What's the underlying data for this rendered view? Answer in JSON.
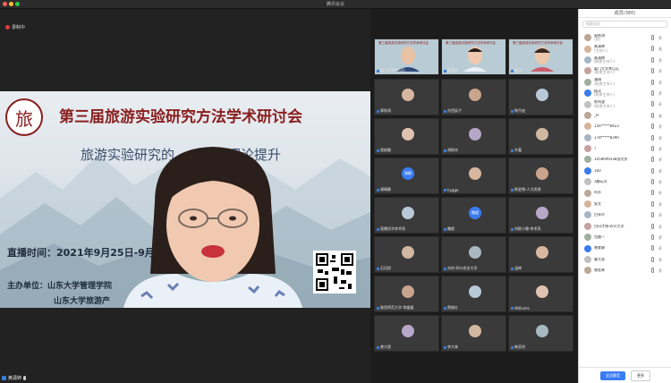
{
  "window": {
    "title": "腾讯会议"
  },
  "recording": {
    "label": "录制中"
  },
  "main": {
    "speaker_name": "黄潇婷",
    "slide": {
      "seal_char": "旅",
      "title": "第三届旅游实验研究方法学术研讨会",
      "subtitle": "旅游实验研究的",
      "subtitle_tail": "与理论提升",
      "dates": "直播时间：2021年9月25日-9月26日",
      "host_line1": "主办单位：山东大学管理学院",
      "host_line2": "山东大学旅游产"
    }
  },
  "gallery": {
    "video_tiles": [
      {
        "name": "厦门大学李山石"
      },
      {
        "name": "黄潇婷"
      },
      {
        "name": "杨洋"
      }
    ],
    "tiles": [
      {
        "name": "郭秋琪",
        "avatar": "photo"
      },
      {
        "name": "孙西辰子",
        "avatar": "photo"
      },
      {
        "name": "陈丹迪",
        "avatar": "photo"
      },
      {
        "name": "程韵融",
        "avatar": "photo"
      },
      {
        "name": "胡航舟",
        "avatar": "photo"
      },
      {
        "name": "许嘉",
        "avatar": "photo"
      },
      {
        "name": "谢晴静",
        "avatar": "text",
        "avatar_text": "谢静"
      },
      {
        "name": "hygge",
        "avatar": "photo"
      },
      {
        "name": "杨宜钢-人力资源",
        "avatar": "photo"
      },
      {
        "name": "直播员华李术亮",
        "avatar": "photo"
      },
      {
        "name": "魏超",
        "avatar": "text",
        "avatar_text": "魏超"
      },
      {
        "name": "刘欧小雅-李术亮",
        "avatar": "photo"
      },
      {
        "name": "石培娇",
        "avatar": "photo"
      },
      {
        "name": "刘杰-四川农业大学",
        "avatar": "photo"
      },
      {
        "name": "温婷",
        "avatar": "photo"
      },
      {
        "name": "陕西师范大学-常媛媛",
        "avatar": "photo"
      },
      {
        "name": "贾维红",
        "avatar": "photo"
      },
      {
        "name": "Williams",
        "avatar": "photo"
      },
      {
        "name": "曾大智",
        "avatar": "photo"
      },
      {
        "name": "李大林",
        "avatar": "photo"
      },
      {
        "name": "韩亚琼",
        "avatar": "photo"
      }
    ]
  },
  "panel": {
    "title": "成员(380)",
    "search_placeholder": "搜索成员",
    "members": [
      {
        "name": "郭秋琪",
        "role": "(我)",
        "video": "开"
      },
      {
        "name": "黄潇婷",
        "role": "(主持人)",
        "video": "关"
      },
      {
        "name": "黄潇婷",
        "role": "(联席主持人)",
        "video": "开"
      },
      {
        "name": "厦门大学李山石",
        "role": "(联席主持人)",
        "video": "开"
      },
      {
        "name": "潘瑞",
        "role": "(联席主持人)",
        "video": "开"
      },
      {
        "name": "杨洋",
        "role": "(联席主持人)",
        "video": "开"
      },
      {
        "name": "陈伟波",
        "role": "(联席主持人)",
        "video": "开"
      },
      {
        "name": "_H",
        "role": "",
        "video": "关"
      },
      {
        "name": "156*****6823",
        "role": "",
        "video": "开"
      },
      {
        "name": "178*****8390",
        "role": "",
        "video": "开"
      },
      {
        "name": "?",
        "role": "",
        "video": "开"
      },
      {
        "name": "1058699338邵文庆",
        "role": "",
        "video": "开"
      },
      {
        "name": "160",
        "role": "",
        "video": "开"
      },
      {
        "name": "3趣玩洋",
        "role": "",
        "video": "开"
      },
      {
        "name": "阿水",
        "role": "",
        "video": "开"
      },
      {
        "name": "安文",
        "role": "",
        "video": "开"
      },
      {
        "name": "白菲玲",
        "role": "",
        "video": "开"
      },
      {
        "name": "白玛才措-四川大学",
        "role": "",
        "video": "开"
      },
      {
        "name": "包晨一",
        "role": "",
        "video": "开"
      },
      {
        "name": "曾蒙静",
        "role": "",
        "video": "开"
      },
      {
        "name": "曹大智",
        "role": "",
        "video": "开"
      },
      {
        "name": "曾若寒",
        "role": "",
        "video": "开"
      }
    ],
    "buttons": {
      "mute_all": "全员静音",
      "more": "更多"
    }
  }
}
